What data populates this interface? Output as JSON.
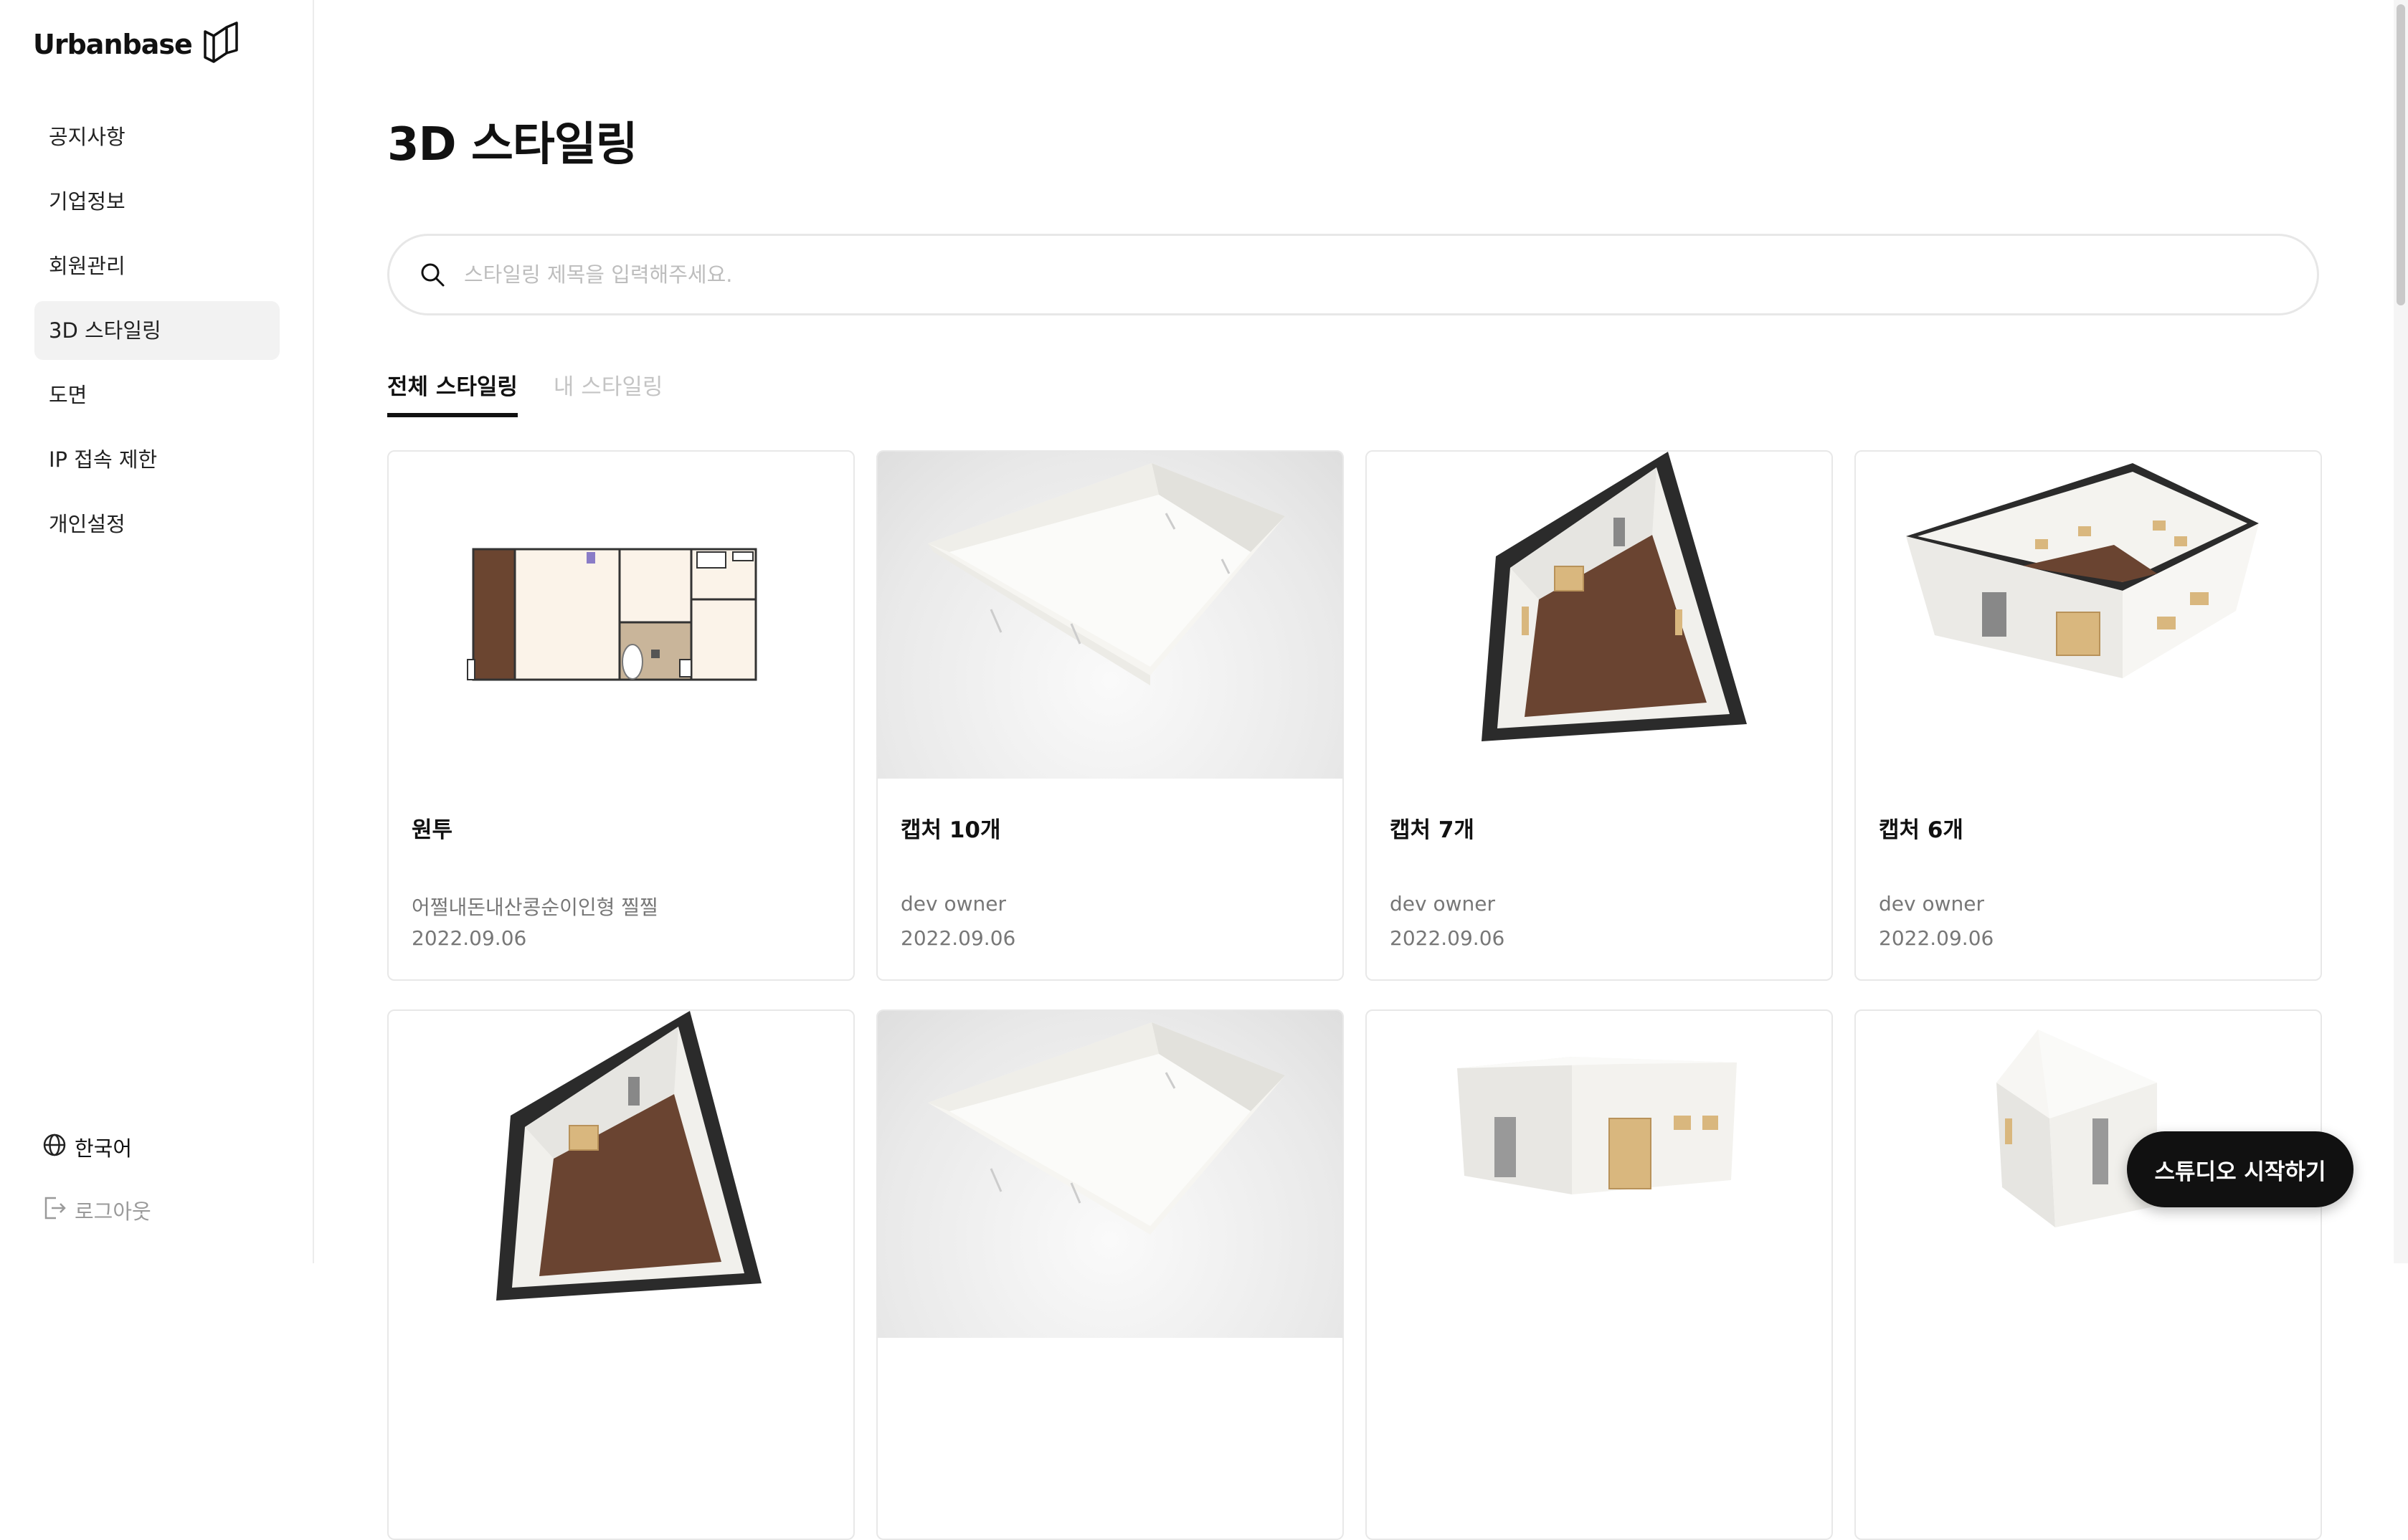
{
  "app": {
    "logo_text": "Urbanbase"
  },
  "sidebar": {
    "items": [
      {
        "label": "공지사항",
        "active": false
      },
      {
        "label": "기업정보",
        "active": false
      },
      {
        "label": "회원관리",
        "active": false
      },
      {
        "label": "3D 스타일링",
        "active": true
      },
      {
        "label": "도면",
        "active": false
      },
      {
        "label": "IP 접속 제한",
        "active": false
      },
      {
        "label": "개인설정",
        "active": false
      }
    ],
    "language_label": "한국어",
    "logout_label": "로그아웃"
  },
  "main": {
    "title": "3D 스타일링",
    "search": {
      "placeholder": "스타일링 제목을 입력해주세요.",
      "value": ""
    },
    "tabs": [
      {
        "label": "전체 스타일링",
        "active": true
      },
      {
        "label": "내 스타일링",
        "active": false
      }
    ],
    "cards": [
      {
        "title": "원투",
        "owner": "어쩔내돈내산콩순이인형 찔찔",
        "date": "2022.09.06",
        "thumbnail": "floorplan"
      },
      {
        "title": "캡처 10개",
        "owner": "dev owner",
        "date": "2022.09.06",
        "thumbnail": "white-room"
      },
      {
        "title": "캡처 7개",
        "owner": "dev owner",
        "date": "2022.09.06",
        "thumbnail": "tilted-room"
      },
      {
        "title": "캡처 6개",
        "owner": "dev owner",
        "date": "2022.09.06",
        "thumbnail": "open-room"
      },
      {
        "title": "",
        "owner": "",
        "date": "",
        "thumbnail": "tilted-room"
      },
      {
        "title": "",
        "owner": "",
        "date": "",
        "thumbnail": "white-room"
      },
      {
        "title": "",
        "owner": "",
        "date": "",
        "thumbnail": "closed-house"
      },
      {
        "title": "",
        "owner": "",
        "date": "",
        "thumbnail": "closed-box"
      }
    ]
  },
  "fab": {
    "label": "스튜디오 시작하기"
  },
  "colors": {
    "accent": "#111111",
    "active_nav_bg": "#f2f2f2",
    "muted_text": "#777777"
  }
}
